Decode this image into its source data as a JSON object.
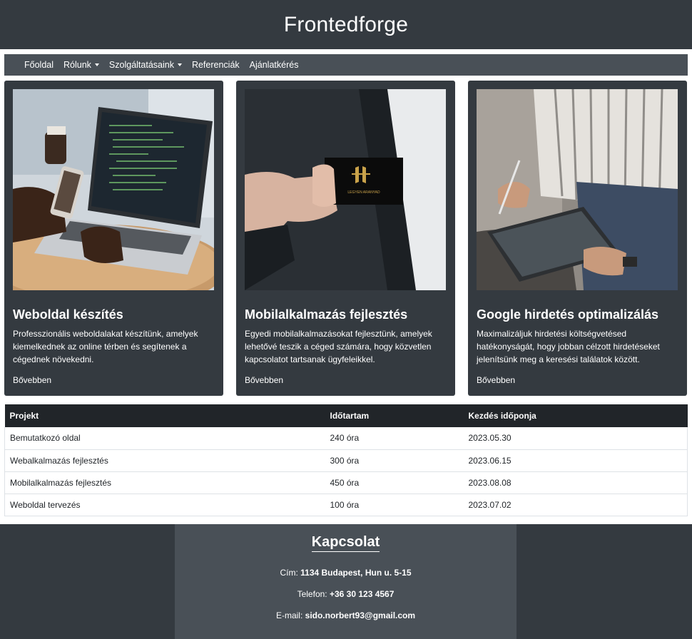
{
  "header": {
    "title": "Frontedforge"
  },
  "nav": {
    "items": [
      {
        "label": "Főoldal",
        "dropdown": false
      },
      {
        "label": "Rólunk",
        "dropdown": true
      },
      {
        "label": "Szolgáltatásaink",
        "dropdown": true
      },
      {
        "label": "Referenciák",
        "dropdown": false
      },
      {
        "label": "Ajánlatkérés",
        "dropdown": false
      }
    ]
  },
  "cards": [
    {
      "image": "laptop-coding-photo",
      "title": "Weboldal készítés",
      "text": "Professzionális weboldalakat készítünk, amelyek kiemelkednek az online térben és segítenek a cégednek növekedni.",
      "link": "Bővebben"
    },
    {
      "image": "business-card-photo",
      "image_caption": "LEGYEN ARANYAD",
      "title": "Mobilalkalmazás fejlesztés",
      "text": "Egyedi mobilalkalmazásokat fejlesztünk, amelyek lehetővé teszik a céged számára, hogy közvetlen kapcsolatot tartsanak ügyfeleikkel.",
      "link": "Bővebben"
    },
    {
      "image": "tablet-stylus-photo",
      "title": "Google hirdetés optimalizálás",
      "text": "Maximalizáljuk hirdetési költségvetésed hatékonyságát, hogy jobban célzott hirdetéseket jelenítsünk meg a keresési találatok között.",
      "link": "Bővebben"
    }
  ],
  "table": {
    "headers": [
      "Projekt",
      "Időtartam",
      "Kezdés időponja"
    ],
    "rows": [
      [
        "Bemutatkozó oldal",
        "240 óra",
        "2023.05.30"
      ],
      [
        "Webalkalmazás fejlesztés",
        "300 óra",
        "2023.06.15"
      ],
      [
        "Mobilalkalmazás fejlesztés",
        "450 óra",
        "2023.08.08"
      ],
      [
        "Weboldal tervezés",
        "100 óra",
        "2023.07.02"
      ]
    ]
  },
  "footer": {
    "title": "Kapcsolat",
    "address_label": "Cím:",
    "address": "1134 Budapest, Hun u. 5-15",
    "phone_label": "Telefon:",
    "phone": "+36 30 123 4567",
    "email_label": "E-mail:",
    "email": "sido.norbert93@gmail.com"
  },
  "colors": {
    "header_bg": "#343a40",
    "nav_bg": "#495057",
    "card_bg": "#343a40",
    "table_head_bg": "#212529"
  }
}
